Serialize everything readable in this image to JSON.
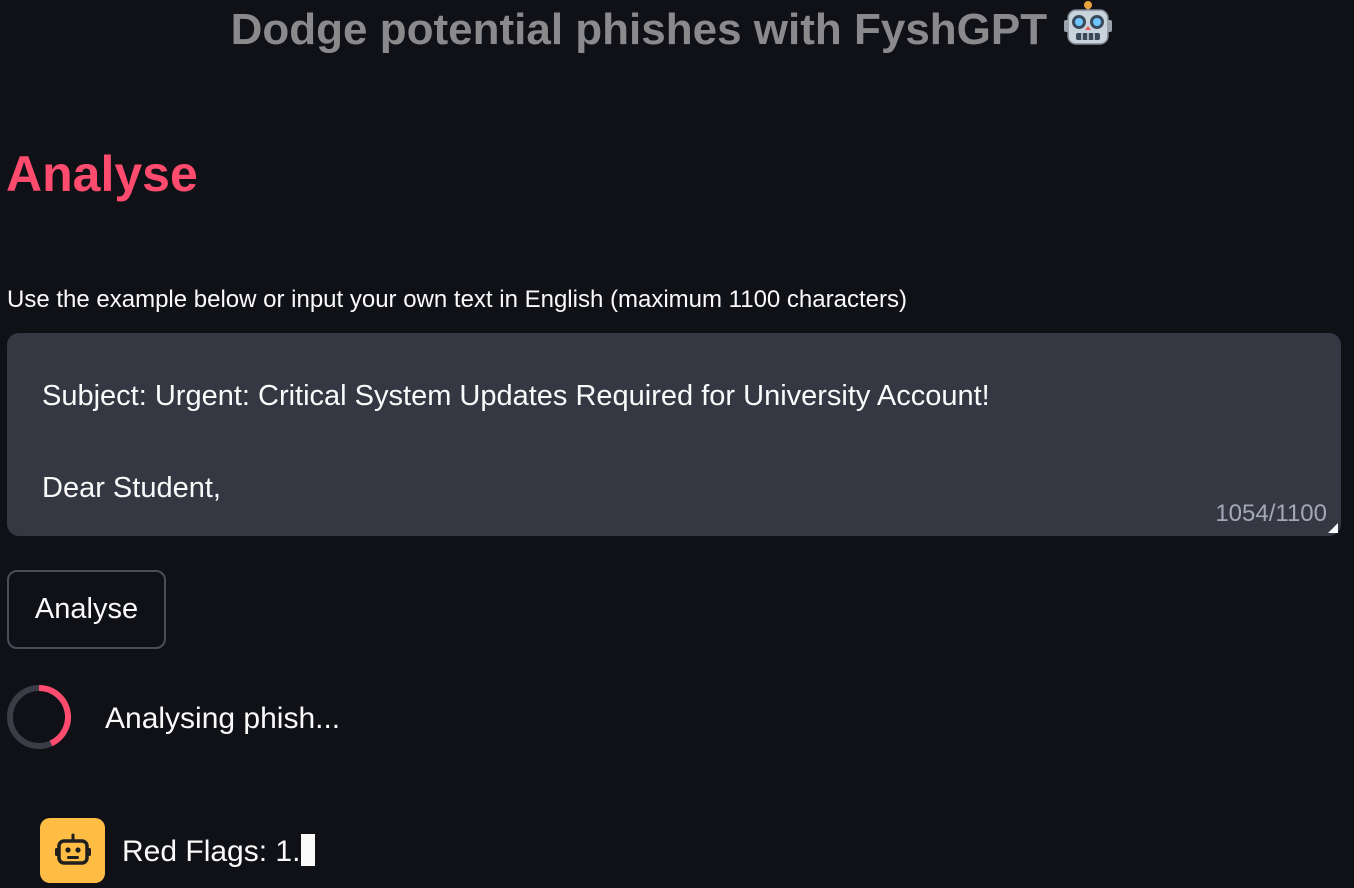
{
  "header": {
    "title": "Dodge potential phishes with FyshGPT",
    "title_emoji": "robot-icon"
  },
  "analyse_section": {
    "heading": "Analyse",
    "input_label": "Use the example below or input your own text in English (maximum 1100 characters)",
    "textarea_value": "Subject: Urgent: Critical System Updates Required for University Account!\n\nDear Student,",
    "char_counter": "1054/1100",
    "button_label": "Analyse"
  },
  "status": {
    "spinner_text": "Analysing phish..."
  },
  "chat": {
    "avatar_icon": "bot-icon",
    "message": "Red Flags: 1."
  },
  "colors": {
    "background": "#0f1117",
    "accent": "#ff4b6e",
    "avatar_bg": "#ffbd45",
    "textarea_bg": "#353743"
  }
}
